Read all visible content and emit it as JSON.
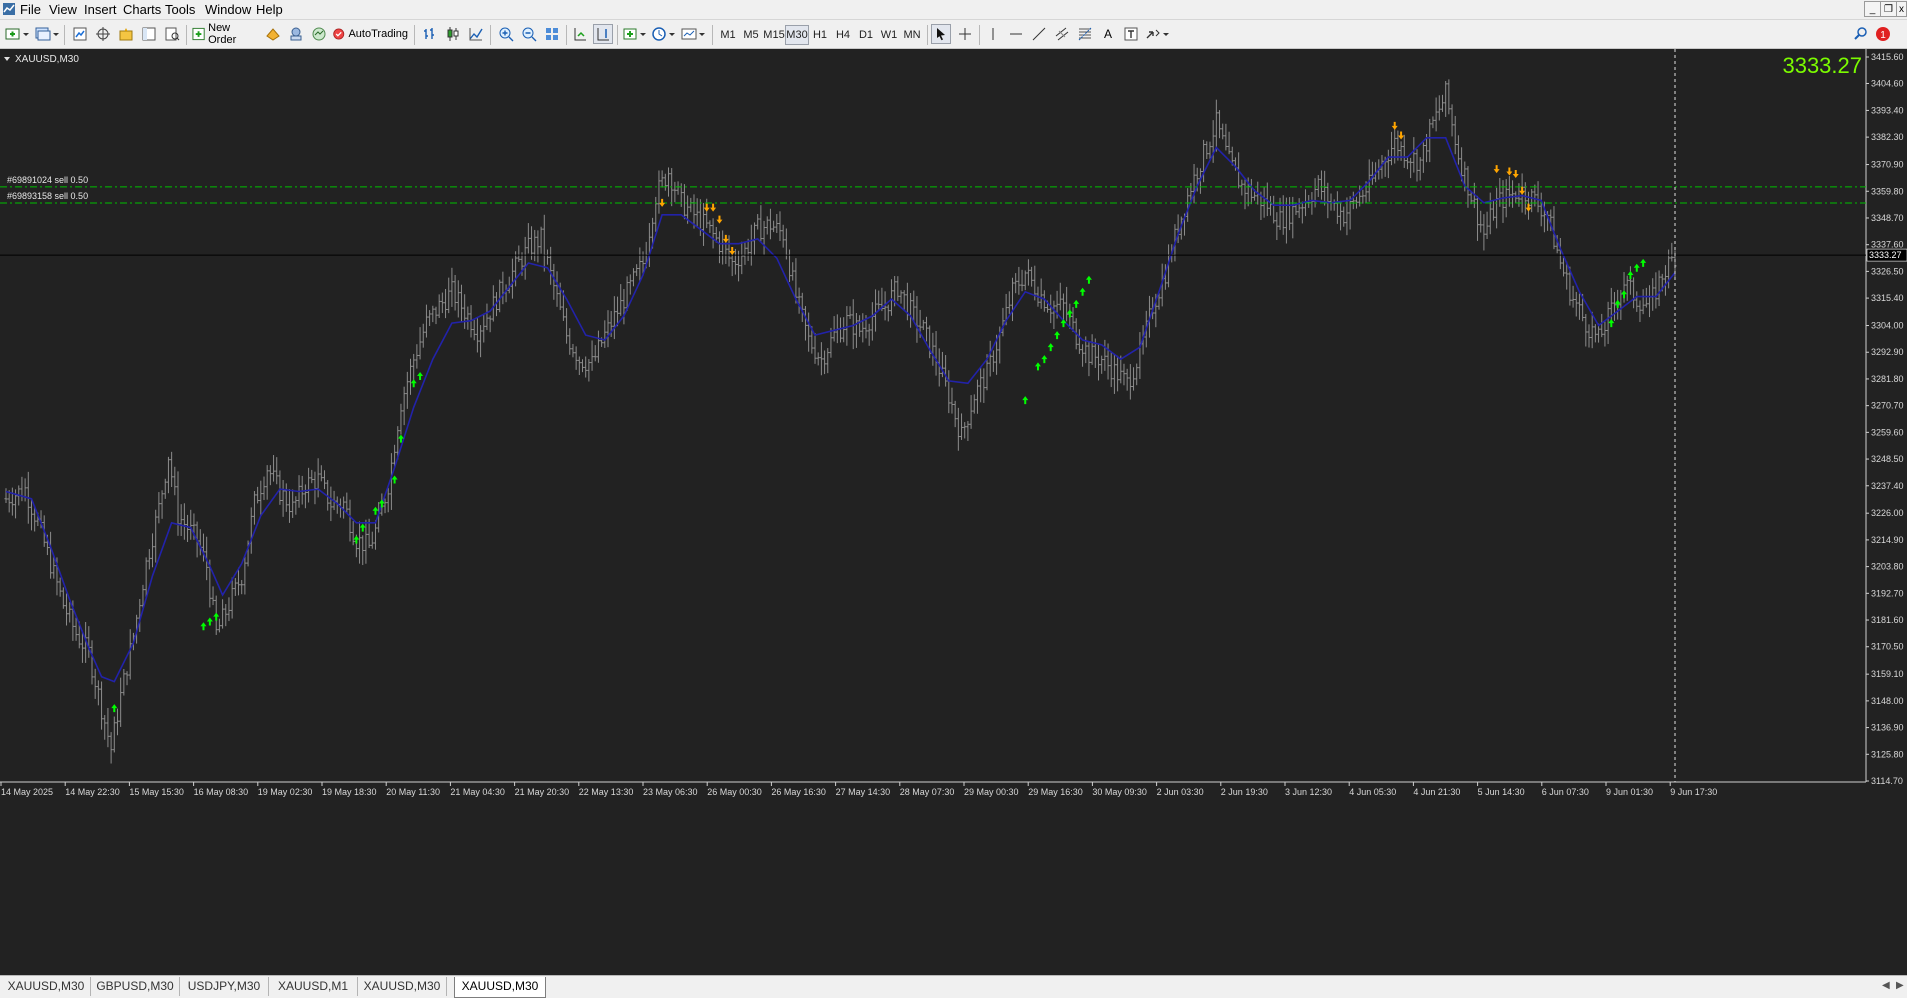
{
  "menu": [
    "File",
    "View",
    "Insert",
    "Charts",
    "Tools",
    "Window",
    "Help"
  ],
  "toolbar": {
    "new_order_label": "New Order",
    "autotrading_label": "AutoTrading",
    "timeframes": [
      "M1",
      "M5",
      "M15",
      "M30",
      "H1",
      "H4",
      "D1",
      "W1",
      "MN"
    ],
    "active_timeframe": "M30"
  },
  "chart": {
    "symbol_label": "XAUUSD,M30",
    "current_price_big": "3333.27",
    "current_price_tag": "3333.27",
    "orders": [
      {
        "label": "#69891024 sell 0.50",
        "price": 3361.6
      },
      {
        "label": "#69893158 sell 0.50",
        "price": 3354.9
      }
    ],
    "colors": {
      "background": "#222222",
      "bars": "#8c8c8c",
      "moving_average": "#2222aa",
      "buy_arrow": "#00ff00",
      "sell_arrow": "#ffa500",
      "order_line": "#00c000",
      "big_price": "#7cfc00"
    }
  },
  "chart_data": {
    "type": "line",
    "title": "XAUUSD,M30",
    "ylim": [
      3114.7,
      3415.6
    ],
    "y_ticks": [
      "3415.60",
      "3404.60",
      "3393.40",
      "3382.30",
      "3370.90",
      "3359.80",
      "3348.70",
      "3337.60",
      "3326.50",
      "3315.40",
      "3304.00",
      "3292.90",
      "3281.80",
      "3270.70",
      "3259.60",
      "3248.50",
      "3237.40",
      "3226.00",
      "3214.90",
      "3203.80",
      "3192.70",
      "3181.60",
      "3170.50",
      "3159.10",
      "3148.00",
      "3136.90",
      "3125.80",
      "3114.70"
    ],
    "x_ticks": [
      "14 May 2025",
      "14 May 22:30",
      "15 May 15:30",
      "16 May 08:30",
      "19 May 02:30",
      "19 May 18:30",
      "20 May 11:30",
      "21 May 04:30",
      "21 May 20:30",
      "22 May 13:30",
      "23 May 06:30",
      "26 May 00:30",
      "26 May 16:30",
      "27 May 14:30",
      "28 May 07:30",
      "29 May 00:30",
      "29 May 16:30",
      "30 May 09:30",
      "2 Jun 03:30",
      "2 Jun 19:30",
      "3 Jun 12:30",
      "4 Jun 05:30",
      "4 Jun 21:30",
      "5 Jun 14:30",
      "6 Jun 07:30",
      "9 Jun 01:30",
      "9 Jun 17:30"
    ],
    "price_path": [
      [
        0,
        3232
      ],
      [
        6,
        3236
      ],
      [
        10,
        3222
      ],
      [
        14,
        3205
      ],
      [
        18,
        3188
      ],
      [
        22,
        3176
      ],
      [
        26,
        3168
      ],
      [
        30,
        3145
      ],
      [
        33,
        3128
      ],
      [
        36,
        3150
      ],
      [
        40,
        3175
      ],
      [
        44,
        3205
      ],
      [
        48,
        3228
      ],
      [
        51,
        3250
      ],
      [
        54,
        3225
      ],
      [
        57,
        3220
      ],
      [
        60,
        3215
      ],
      [
        63,
        3204
      ],
      [
        66,
        3176
      ],
      [
        70,
        3188
      ],
      [
        74,
        3200
      ],
      [
        78,
        3230
      ],
      [
        82,
        3245
      ],
      [
        86,
        3235
      ],
      [
        90,
        3228
      ],
      [
        94,
        3238
      ],
      [
        98,
        3240
      ],
      [
        102,
        3230
      ],
      [
        106,
        3230
      ],
      [
        110,
        3215
      ],
      [
        114,
        3212
      ],
      [
        117,
        3222
      ],
      [
        120,
        3238
      ],
      [
        124,
        3272
      ],
      [
        128,
        3290
      ],
      [
        132,
        3305
      ],
      [
        136,
        3312
      ],
      [
        140,
        3318
      ],
      [
        144,
        3310
      ],
      [
        148,
        3302
      ],
      [
        152,
        3310
      ],
      [
        156,
        3320
      ],
      [
        160,
        3328
      ],
      [
        164,
        3336
      ],
      [
        168,
        3340
      ],
      [
        172,
        3320
      ],
      [
        176,
        3300
      ],
      [
        180,
        3290
      ],
      [
        184,
        3288
      ],
      [
        188,
        3300
      ],
      [
        192,
        3310
      ],
      [
        196,
        3320
      ],
      [
        200,
        3330
      ],
      [
        204,
        3358
      ],
      [
        208,
        3368
      ],
      [
        212,
        3355
      ],
      [
        216,
        3350
      ],
      [
        220,
        3345
      ],
      [
        224,
        3338
      ],
      [
        228,
        3330
      ],
      [
        232,
        3335
      ],
      [
        236,
        3344
      ],
      [
        240,
        3346
      ],
      [
        244,
        3342
      ],
      [
        248,
        3316
      ],
      [
        252,
        3298
      ],
      [
        256,
        3290
      ],
      [
        260,
        3300
      ],
      [
        264,
        3306
      ],
      [
        268,
        3302
      ],
      [
        272,
        3308
      ],
      [
        276,
        3312
      ],
      [
        280,
        3320
      ],
      [
        284,
        3310
      ],
      [
        288,
        3302
      ],
      [
        292,
        3290
      ],
      [
        296,
        3275
      ],
      [
        300,
        3258
      ],
      [
        304,
        3275
      ],
      [
        308,
        3284
      ],
      [
        312,
        3300
      ],
      [
        316,
        3318
      ],
      [
        320,
        3326
      ],
      [
        324,
        3318
      ],
      [
        328,
        3312
      ],
      [
        332,
        3312
      ],
      [
        336,
        3300
      ],
      [
        340,
        3292
      ],
      [
        344,
        3290
      ],
      [
        348,
        3285
      ],
      [
        352,
        3280
      ],
      [
        356,
        3292
      ],
      [
        360,
        3312
      ],
      [
        364,
        3326
      ],
      [
        368,
        3345
      ],
      [
        372,
        3362
      ],
      [
        376,
        3375
      ],
      [
        380,
        3388
      ],
      [
        384,
        3372
      ],
      [
        388,
        3362
      ],
      [
        392,
        3358
      ],
      [
        396,
        3354
      ],
      [
        400,
        3348
      ],
      [
        404,
        3352
      ],
      [
        408,
        3356
      ],
      [
        412,
        3362
      ],
      [
        416,
        3355
      ],
      [
        420,
        3350
      ],
      [
        424,
        3356
      ],
      [
        428,
        3362
      ],
      [
        432,
        3372
      ],
      [
        436,
        3380
      ],
      [
        440,
        3375
      ],
      [
        444,
        3372
      ],
      [
        448,
        3388
      ],
      [
        452,
        3400
      ],
      [
        456,
        3375
      ],
      [
        460,
        3358
      ],
      [
        464,
        3342
      ],
      [
        468,
        3355
      ],
      [
        472,
        3358
      ],
      [
        476,
        3360
      ],
      [
        480,
        3356
      ],
      [
        484,
        3350
      ],
      [
        488,
        3330
      ],
      [
        492,
        3315
      ],
      [
        496,
        3305
      ],
      [
        500,
        3298
      ],
      [
        504,
        3310
      ],
      [
        508,
        3322
      ],
      [
        512,
        3315
      ],
      [
        516,
        3312
      ],
      [
        520,
        3325
      ],
      [
        524,
        3333.27
      ]
    ],
    "moving_average_path": [
      [
        0,
        3235
      ],
      [
        8,
        3232
      ],
      [
        14,
        3212
      ],
      [
        20,
        3190
      ],
      [
        26,
        3170
      ],
      [
        30,
        3158
      ],
      [
        34,
        3156
      ],
      [
        40,
        3172
      ],
      [
        46,
        3200
      ],
      [
        52,
        3222
      ],
      [
        58,
        3220
      ],
      [
        64,
        3204
      ],
      [
        68,
        3192
      ],
      [
        74,
        3205
      ],
      [
        80,
        3225
      ],
      [
        86,
        3236
      ],
      [
        92,
        3235
      ],
      [
        98,
        3236
      ],
      [
        104,
        3230
      ],
      [
        110,
        3222
      ],
      [
        116,
        3222
      ],
      [
        122,
        3245
      ],
      [
        128,
        3270
      ],
      [
        134,
        3290
      ],
      [
        140,
        3305
      ],
      [
        146,
        3306
      ],
      [
        152,
        3310
      ],
      [
        158,
        3320
      ],
      [
        164,
        3330
      ],
      [
        170,
        3328
      ],
      [
        176,
        3315
      ],
      [
        182,
        3300
      ],
      [
        188,
        3298
      ],
      [
        194,
        3308
      ],
      [
        200,
        3325
      ],
      [
        206,
        3350
      ],
      [
        212,
        3350
      ],
      [
        218,
        3344
      ],
      [
        224,
        3338
      ],
      [
        230,
        3338
      ],
      [
        236,
        3340
      ],
      [
        242,
        3332
      ],
      [
        248,
        3315
      ],
      [
        254,
        3300
      ],
      [
        260,
        3302
      ],
      [
        266,
        3304
      ],
      [
        272,
        3308
      ],
      [
        278,
        3315
      ],
      [
        284,
        3308
      ],
      [
        290,
        3294
      ],
      [
        296,
        3281
      ],
      [
        302,
        3280
      ],
      [
        308,
        3290
      ],
      [
        314,
        3306
      ],
      [
        320,
        3318
      ],
      [
        326,
        3315
      ],
      [
        332,
        3306
      ],
      [
        338,
        3298
      ],
      [
        344,
        3296
      ],
      [
        350,
        3290
      ],
      [
        356,
        3295
      ],
      [
        362,
        3318
      ],
      [
        368,
        3342
      ],
      [
        374,
        3362
      ],
      [
        380,
        3378
      ],
      [
        386,
        3370
      ],
      [
        392,
        3360
      ],
      [
        398,
        3354
      ],
      [
        404,
        3354
      ],
      [
        410,
        3356
      ],
      [
        416,
        3355
      ],
      [
        422,
        3356
      ],
      [
        428,
        3364
      ],
      [
        434,
        3374
      ],
      [
        440,
        3374
      ],
      [
        446,
        3382
      ],
      [
        452,
        3382
      ],
      [
        458,
        3362
      ],
      [
        464,
        3355
      ],
      [
        470,
        3357
      ],
      [
        476,
        3358
      ],
      [
        482,
        3356
      ],
      [
        488,
        3336
      ],
      [
        494,
        3318
      ],
      [
        500,
        3304
      ],
      [
        506,
        3310
      ],
      [
        512,
        3316
      ],
      [
        518,
        3316
      ],
      [
        524,
        3326
      ]
    ],
    "buy_signals": [
      [
        34,
        3150
      ],
      [
        62,
        3184
      ],
      [
        64,
        3186
      ],
      [
        66,
        3188
      ],
      [
        110,
        3220
      ],
      [
        112,
        3225
      ],
      [
        116,
        3232
      ],
      [
        118,
        3235
      ],
      [
        122,
        3245
      ],
      [
        124,
        3262
      ],
      [
        128,
        3285
      ],
      [
        130,
        3288
      ],
      [
        320,
        3278
      ],
      [
        324,
        3292
      ],
      [
        326,
        3295
      ],
      [
        328,
        3300
      ],
      [
        330,
        3305
      ],
      [
        332,
        3310
      ],
      [
        334,
        3314
      ],
      [
        336,
        3318
      ],
      [
        338,
        3323
      ],
      [
        340,
        3328
      ],
      [
        504,
        3310
      ],
      [
        506,
        3318
      ],
      [
        508,
        3322
      ],
      [
        510,
        3330
      ],
      [
        512,
        3333
      ],
      [
        514,
        3335
      ]
    ],
    "sell_signals": [
      [
        206,
        3350
      ],
      [
        220,
        3348
      ],
      [
        222,
        3348
      ],
      [
        224,
        3343
      ],
      [
        226,
        3335
      ],
      [
        228,
        3330
      ],
      [
        436,
        3382
      ],
      [
        438,
        3378
      ],
      [
        468,
        3364
      ],
      [
        472,
        3363
      ],
      [
        474,
        3362
      ],
      [
        476,
        3355
      ],
      [
        478,
        3348
      ]
    ]
  }
}
